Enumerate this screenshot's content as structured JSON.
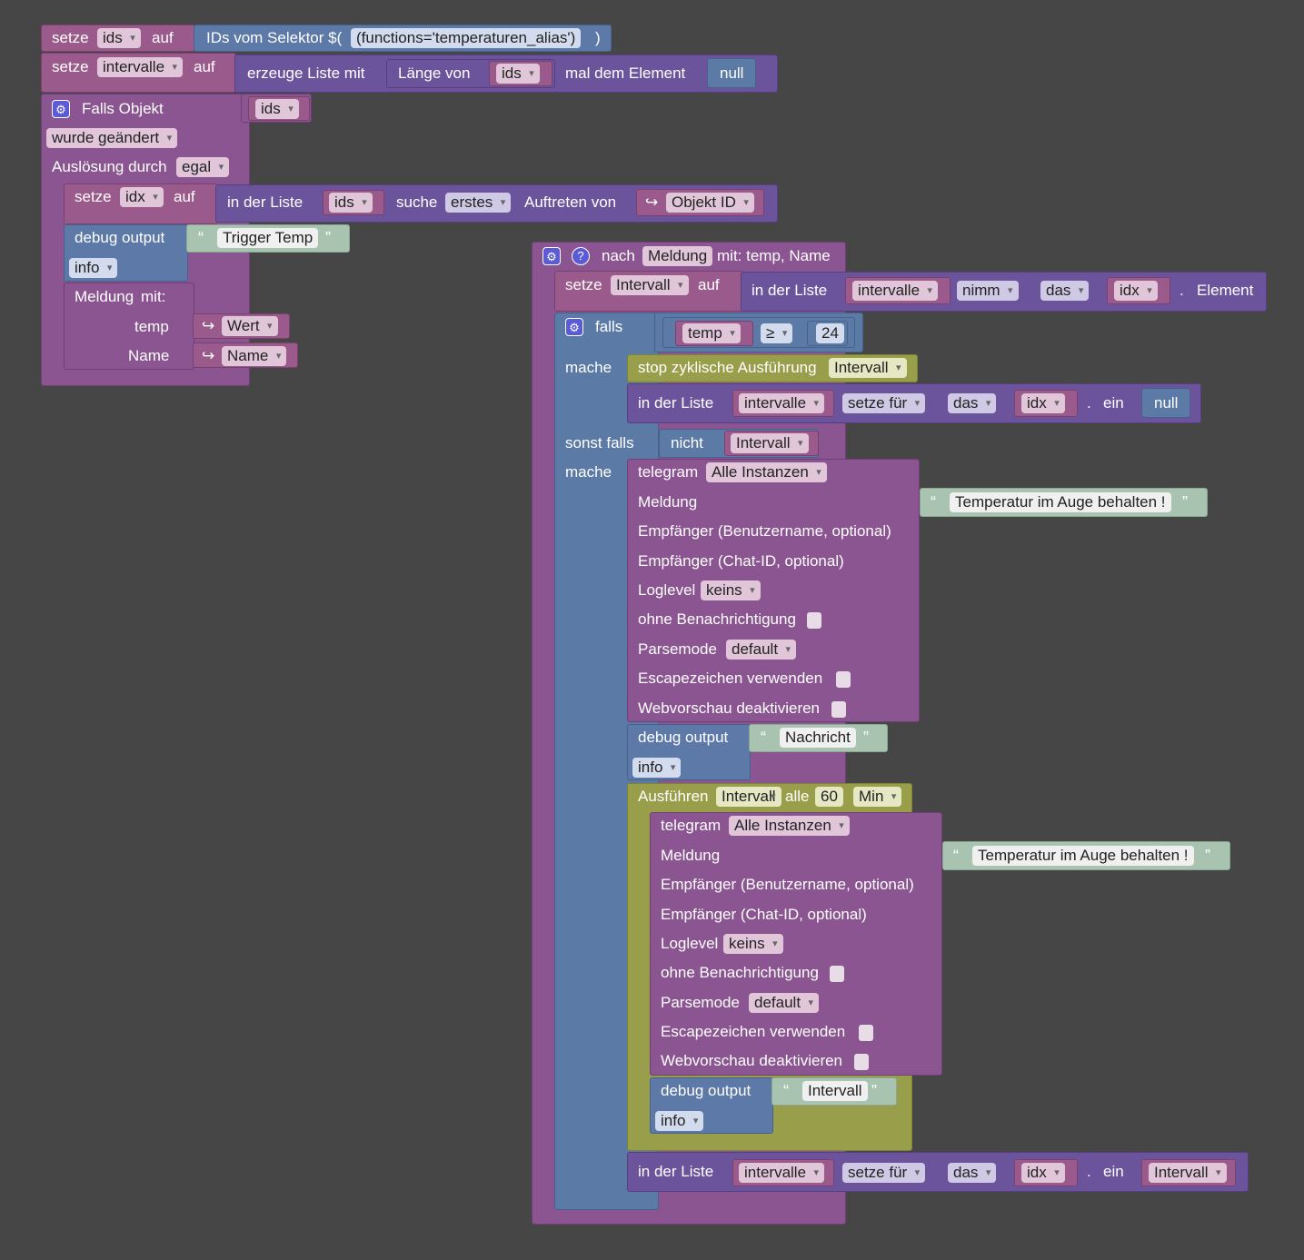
{
  "colors": {
    "variable": "#9b5a8c",
    "list": "#6b549c",
    "selector": "#5d79a8",
    "event": "#8a5590",
    "logic": "#5c7aa6",
    "timer": "#989e4a",
    "text": "#a8c4b0",
    "background": "#464646"
  },
  "icons": {
    "gear": "gear-icon",
    "help": "help-icon",
    "arrow": "return-arrow-icon"
  },
  "kw": {
    "setze": "setze",
    "auf": "auf",
    "in_der_liste": "in der Liste",
    "mache": "mache",
    "sonst_falls": "sonst falls",
    "nicht": "nicht",
    "falls": "falls",
    "ein": "ein",
    "dot": ".",
    "element": "Element",
    "debug_output": "debug output",
    "telegram": "telegram",
    "meldung": "Meldung",
    "null": "null",
    "open_q": "“",
    "close_q": "”",
    "arrow": "↪",
    "gear": "⚙",
    "help": "?"
  },
  "b1": {
    "var": "ids",
    "selector": "IDs vom Selektor $(",
    "selector_value": "(functions='temperaturen_alias')",
    "close": ")"
  },
  "b2": {
    "var": "intervalle",
    "create": "erzeuge Liste mit",
    "length_of": "Länge von",
    "ids": "ids",
    "times": "mal dem Element",
    "null": "null"
  },
  "trigger": {
    "title": "Falls Objekt",
    "var": "ids",
    "changed": "wurde geändert",
    "trigger_by": "Auslösung durch",
    "trigger_val": "egal",
    "set_idx": "idx",
    "list": "ids",
    "search": "suche",
    "first": "erstes",
    "occurrence": "Auftreten von",
    "obj_id": "Objekt ID",
    "debug_text": "Trigger Temp",
    "debug_level": "info",
    "msg": "Meldung",
    "msg_with": "mit:",
    "p_temp": "temp",
    "p_name": "Name",
    "wert": "Wert",
    "name_val": "Name"
  },
  "func": {
    "nach": "nach",
    "func_name": "Meldung",
    "params": "mit: temp, Name",
    "set_var": "Intervall",
    "list": "intervalle",
    "take": "nimm",
    "das": "das",
    "idx": "idx",
    "cond_var": "temp",
    "op": "≥",
    "cond_val": "24",
    "stop": "stop zyklische Ausführung",
    "stop_var": "Intervall",
    "set_for": "setze für",
    "not_var": "Intervall",
    "tg_inst": "Alle Instanzen",
    "tg_msg": "Temperatur im Auge behalten !",
    "tg_user": "Empfänger (Benutzername, optional)",
    "tg_chat": "Empfänger (Chat-ID, optional)",
    "loglevel": "Loglevel",
    "loglevel_val": "keins",
    "no_notify": "ohne Benachrichtigung",
    "parsemode": "Parsemode",
    "parsemode_val": "default",
    "escape": "Escapezeichen verwenden",
    "webpreview": "Webvorschau deaktivieren",
    "dbg1_text": "Nachricht",
    "dbg_level": "info",
    "run": "Ausführen",
    "run_var": "Intervall",
    "every": "alle",
    "every_val": "60",
    "unit": "Min",
    "dbg2_text": "Intervall",
    "set_val": "Intervall"
  }
}
